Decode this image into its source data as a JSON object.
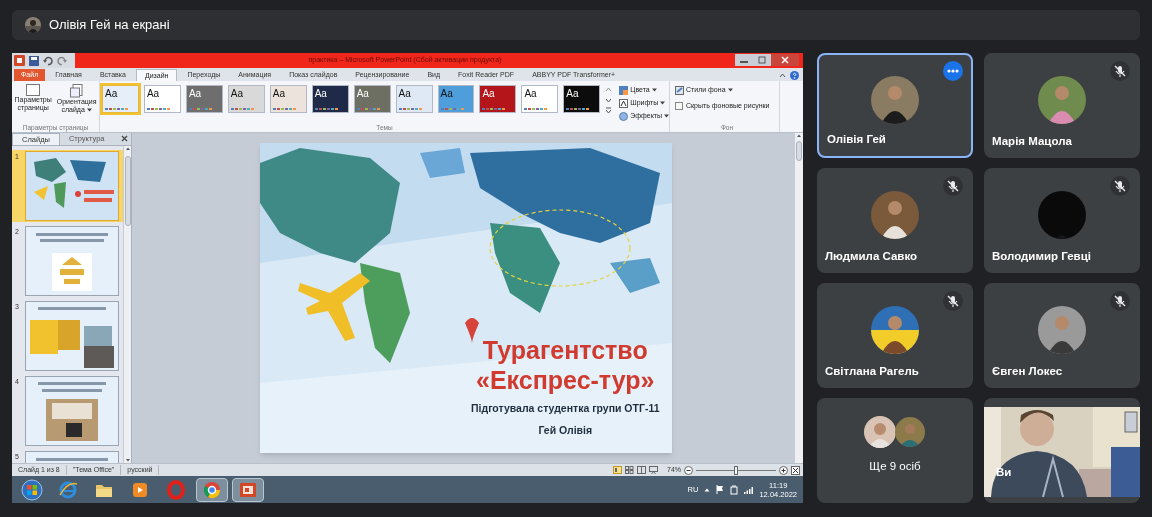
{
  "presenter_bar": {
    "label": "Олівія Гей на екрані"
  },
  "shared_screen": {
    "window_title": "практика – Microsoft PowerPoint (Сбой активации продукта)",
    "ribbon_tabs": [
      {
        "label": "Файл",
        "kind": "file",
        "selected": false
      },
      {
        "label": "Главная",
        "kind": "tab",
        "selected": false
      },
      {
        "label": "Вставка",
        "kind": "tab",
        "selected": false
      },
      {
        "label": "Дизайн",
        "kind": "tab",
        "selected": true
      },
      {
        "label": "Переходы",
        "kind": "tab",
        "selected": false
      },
      {
        "label": "Анимация",
        "kind": "tab",
        "selected": false
      },
      {
        "label": "Показ слайдов",
        "kind": "tab",
        "selected": false
      },
      {
        "label": "Рецензирование",
        "kind": "tab",
        "selected": false
      },
      {
        "label": "Вид",
        "kind": "tab",
        "selected": false
      },
      {
        "label": "Foxit Reader PDF",
        "kind": "tab",
        "selected": false
      },
      {
        "label": "ABBYY PDF Transformer+",
        "kind": "tab",
        "selected": false
      }
    ],
    "page_setup": {
      "buttons": [
        {
          "label": "Параметры страницы",
          "dropdown": false
        },
        {
          "label": "Ориентация слайда",
          "dropdown": true
        }
      ],
      "group_label": "Параметры страницы"
    },
    "themes": {
      "items": [
        {
          "label": "Aa",
          "color": "#e6eff9",
          "selected": true
        },
        {
          "label": "Aa",
          "color": "#ffffff",
          "selected": false
        },
        {
          "label": "Aa",
          "color": "#6e6e6e",
          "selected": false
        },
        {
          "label": "Aa",
          "color": "#d9d9d9",
          "selected": false
        },
        {
          "label": "Aa",
          "color": "#ece4dc",
          "selected": false
        },
        {
          "label": "Aa",
          "color": "#1f2a48",
          "selected": false
        },
        {
          "label": "Aa",
          "color": "#6d6f63",
          "selected": false
        },
        {
          "label": "Aa",
          "color": "#dfe9f5",
          "selected": false
        },
        {
          "label": "Aa",
          "color": "#4d9edb",
          "selected": false
        },
        {
          "label": "Aa",
          "color": "#b3151a",
          "selected": false
        },
        {
          "label": "Aa",
          "color": "#ffffff",
          "selected": false
        },
        {
          "label": "Aa",
          "color": "#0c0c0c",
          "selected": false
        }
      ],
      "options": [
        {
          "label": "Цвета"
        },
        {
          "label": "Шрифты"
        },
        {
          "label": "Эффекты"
        }
      ],
      "group_label": "Темы"
    },
    "background": {
      "styles_label": "Стили фона",
      "hide_graphics": {
        "label": "Скрыть фоновые рисунки",
        "checked": false
      },
      "group_label": "Фон"
    },
    "panel_tabs": [
      {
        "label": "Слайды",
        "selected": true
      },
      {
        "label": "Структура",
        "selected": false
      }
    ],
    "slides": [
      {
        "number": "1",
        "selected": true
      },
      {
        "number": "2",
        "selected": false
      },
      {
        "number": "3",
        "selected": false
      },
      {
        "number": "4",
        "selected": false
      },
      {
        "number": "5",
        "selected": false
      }
    ],
    "slide": {
      "title": "Турагентство",
      "subtitle": "«Експрес-тур»",
      "author_line": "Підготувала студентка групи ОТГ-11",
      "name_line": "Гей Олівія"
    },
    "status_bar": {
      "slide_info": "Слайд 1 из 8",
      "theme": "\"Тема Office\"",
      "language": "русский",
      "zoom": "74%",
      "zoom_slider": {
        "level": 0.5
      }
    },
    "taskbar": {
      "apps": [
        {
          "kind": "start",
          "running": false
        },
        {
          "kind": "browser",
          "running": false
        },
        {
          "kind": "folder",
          "running": false
        },
        {
          "kind": "player",
          "running": false
        },
        {
          "kind": "opera",
          "running": false
        },
        {
          "kind": "chrome",
          "running": true
        },
        {
          "kind": "presentation",
          "running": true
        }
      ],
      "language": "RU",
      "time": "11:19",
      "date": "12.04.2022"
    }
  },
  "participants": [
    {
      "kind": "avatar",
      "name": "Олівія Гей",
      "muted": false,
      "selected": true
    },
    {
      "kind": "avatar",
      "name": "Марія Мацола",
      "muted": true,
      "selected": false
    },
    {
      "kind": "avatar",
      "name": "Людмила Савко",
      "muted": true,
      "selected": false
    },
    {
      "kind": "avatar",
      "name": "Володимир Гевці",
      "muted": true,
      "selected": false
    },
    {
      "kind": "avatar",
      "name": "Світлана Рагель",
      "muted": true,
      "selected": false
    },
    {
      "kind": "avatar",
      "name": "Євген Локес",
      "muted": true,
      "selected": false
    },
    {
      "kind": "group",
      "name": "Ще 9 осіб",
      "muted": false,
      "selected": false
    },
    {
      "kind": "video",
      "name": "Ви",
      "muted": false,
      "selected": false
    }
  ]
}
